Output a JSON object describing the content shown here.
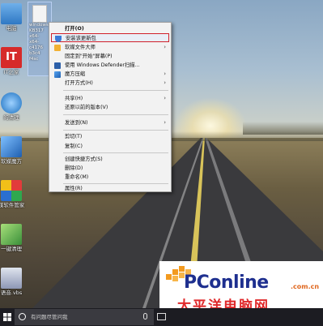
{
  "desktop": {
    "icons": [
      {
        "label": "电脑",
        "color": "#4a90d9"
      },
      {
        "label": "IT之家",
        "color": "#d62a2a"
      },
      {
        "label": "的清理",
        "color": "#2b7fd0"
      },
      {
        "label": "软媒魔方",
        "color": "#2c6fc0"
      },
      {
        "label": "媒软件管家",
        "color": "#1a8a4a"
      },
      {
        "label": "一键清理",
        "color": "#4aa84a"
      },
      {
        "label": "语音.vbs",
        "color": "#7a7aa0"
      }
    ],
    "selected_item": {
      "lines": [
        "windows",
        "KB317",
        "x64-",
        "x64-",
        "c4176",
        "b3c4",
        "f4sc"
      ]
    }
  },
  "context_menu": {
    "items": [
      {
        "label": "打开(O)",
        "bold": true,
        "icon": "",
        "arrow": false
      },
      {
        "label": "安装该更新包",
        "highlighted": true,
        "icon": "shield-icon",
        "arrow": false
      },
      {
        "label": "软媒文件大师",
        "icon": "folder-icon",
        "arrow": true
      },
      {
        "label": "固定到\"开始\"屏幕(P)",
        "icon": "",
        "arrow": false
      },
      {
        "label": "使用 Windows Defender扫描...",
        "icon": "defender-icon",
        "arrow": false
      },
      {
        "label": "魔方压缩",
        "icon": "cube-icon",
        "arrow": true
      },
      {
        "label": "打开方式(H)",
        "icon": "",
        "arrow": true
      },
      {
        "label": "共享(H)",
        "icon": "",
        "arrow": true
      },
      {
        "label": "还原以前的版本(V)",
        "icon": "",
        "arrow": false
      },
      {
        "label": "发送到(N)",
        "icon": "",
        "arrow": true
      },
      {
        "label": "剪切(T)",
        "icon": "",
        "arrow": false
      },
      {
        "label": "复制(C)",
        "icon": "",
        "arrow": false
      },
      {
        "label": "创建快捷方式(S)",
        "icon": "",
        "arrow": false
      },
      {
        "label": "删除(D)",
        "icon": "",
        "arrow": false
      },
      {
        "label": "重命名(M)",
        "icon": "",
        "arrow": false
      },
      {
        "label": "属性(R)",
        "icon": "",
        "arrow": false
      }
    ]
  },
  "taskbar": {
    "search_placeholder": "有问题尽管问我",
    "windows_icon": "windows-logo-icon",
    "search_icon": "cortana-icon",
    "mic_icon": "microphone-icon",
    "task_view_icon": "task-view-icon"
  },
  "watermark": {
    "brand": "PConline",
    "domain": ".com.cn",
    "chinese": "太平洋电脑网",
    "brand_color": "#1e2f8f",
    "accent_color": "#e0282a"
  }
}
